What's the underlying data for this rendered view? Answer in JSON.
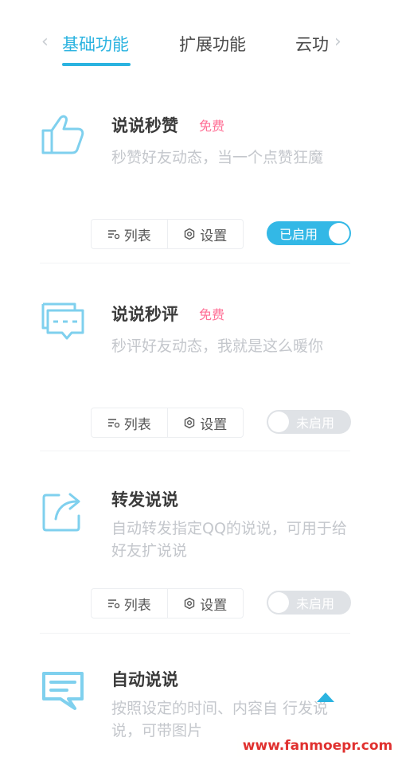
{
  "tabs": {
    "items": [
      {
        "label": "基础功能"
      },
      {
        "label": "扩展功能"
      },
      {
        "label": "云功"
      }
    ],
    "active_index": 0
  },
  "cards": [
    {
      "title": "说说秒赞",
      "badge": "免费",
      "desc": "秒赞好友动态，当一个点赞狂魔",
      "icon": "thumbs-up-icon",
      "list_label": "列表",
      "settings_label": "设置",
      "toggle_label": "已启用",
      "enabled": true
    },
    {
      "title": "说说秒评",
      "badge": "免费",
      "desc": "秒评好友动态，我就是这么暖你",
      "icon": "comment-icon",
      "list_label": "列表",
      "settings_label": "设置",
      "toggle_label": "未启用",
      "enabled": false
    },
    {
      "title": "转发说说",
      "desc": "自动转发指定QQ的说说，可用于给好友扩说说",
      "icon": "share-icon",
      "list_label": "列表",
      "settings_label": "设置",
      "toggle_label": "未启用",
      "enabled": false
    },
    {
      "title": "自动说说",
      "desc": "按照设定的时间、内容自 行发说说，可带图片",
      "icon": "message-icon"
    }
  ],
  "watermark": "www.fanmoepr.com",
  "colors": {
    "accent": "#2bb3e0",
    "badge": "#ff6f95",
    "icon": "#7fd0ee",
    "toggle_off": "#dfe2e6"
  }
}
